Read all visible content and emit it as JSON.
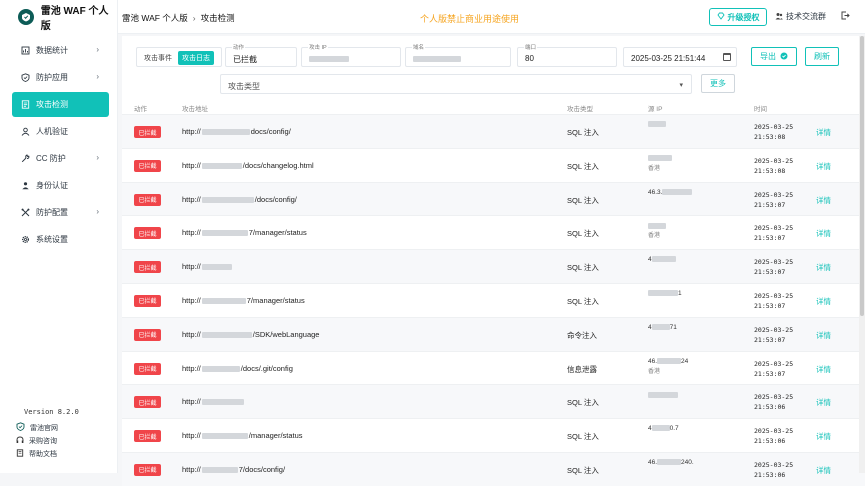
{
  "brand": {
    "name": "雷池 WAF 个人版"
  },
  "breadcrumb": {
    "app": "雷池 WAF 个人版",
    "page": "攻击检测"
  },
  "notice": "个人版禁止商业用途使用",
  "header": {
    "upgrade_label": "升级授权",
    "group_label": "技术交流群"
  },
  "sidebar": {
    "items": [
      {
        "label": "数据统计",
        "icon": "chart-icon",
        "chevron": true
      },
      {
        "label": "防护应用",
        "icon": "shield-icon",
        "chevron": true
      },
      {
        "label": "攻击检测",
        "icon": "document-icon",
        "chevron": false,
        "active": true
      },
      {
        "label": "人机验证",
        "icon": "user-icon",
        "chevron": false
      },
      {
        "label": "CC 防护",
        "icon": "wrench-icon",
        "chevron": true
      },
      {
        "label": "身份认证",
        "icon": "id-icon",
        "chevron": false
      },
      {
        "label": "防护配置",
        "icon": "tools-icon",
        "chevron": true
      },
      {
        "label": "系统设置",
        "icon": "gear-icon",
        "chevron": false
      }
    ],
    "version": "Version 8.2.0",
    "links": [
      {
        "label": "雷池官网",
        "icon": "shield-icon"
      },
      {
        "label": "采购咨询",
        "icon": "headset-icon"
      },
      {
        "label": "帮助文档",
        "icon": "book-icon"
      }
    ]
  },
  "filters": {
    "tab_label": "攻击事件",
    "tab_active": "攻击日志",
    "action": {
      "label": "动作",
      "value": "已拦截"
    },
    "source_ip": {
      "label": "攻击 IP"
    },
    "domain": {
      "label": "域名"
    },
    "port": {
      "label": "端口",
      "value": "80"
    },
    "datetime": "2025-03-25 21:51:44",
    "attack_type": {
      "placeholder": "攻击类型"
    },
    "more_label": "更多",
    "export_label": "导出",
    "refresh_label": "刷新"
  },
  "table": {
    "columns": [
      "动作",
      "攻击地址",
      "攻击类型",
      "源 IP",
      "时间"
    ],
    "detail_label": "详情",
    "rows": [
      {
        "action": "已拦截",
        "url_prefix": "http://",
        "url_suffix": "docs/config/",
        "type": "SQL 注入",
        "ip_start": "",
        "ip_end": "",
        "location": "",
        "date": "2025-03-25",
        "time": "21:53:08"
      },
      {
        "action": "已拦截",
        "url_prefix": "http://",
        "url_suffix": "/docs/changelog.html",
        "type": "SQL 注入",
        "ip_start": "",
        "ip_end": "",
        "location": "香港",
        "date": "2025-03-25",
        "time": "21:53:08"
      },
      {
        "action": "已拦截",
        "url_prefix": "http://",
        "url_suffix": "/docs/config/",
        "type": "SQL 注入",
        "ip_start": "46.3.",
        "ip_end": "",
        "location": "",
        "date": "2025-03-25",
        "time": "21:53:07"
      },
      {
        "action": "已拦截",
        "url_prefix": "http://",
        "url_suffix": "7/manager/status",
        "type": "SQL 注入",
        "ip_start": "",
        "ip_end": "",
        "location": "香港",
        "date": "2025-03-25",
        "time": "21:53:07"
      },
      {
        "action": "已拦截",
        "url_prefix": "http://",
        "url_suffix": "",
        "type": "SQL 注入",
        "ip_start": "4",
        "ip_end": "",
        "location": "",
        "date": "2025-03-25",
        "time": "21:53:07"
      },
      {
        "action": "已拦截",
        "url_prefix": "http://",
        "url_suffix": "7/manager/status",
        "type": "SQL 注入",
        "ip_start": "",
        "ip_end": "1",
        "location": "",
        "date": "2025-03-25",
        "time": "21:53:07"
      },
      {
        "action": "已拦截",
        "url_prefix": "http://",
        "url_suffix": "/SDK/webLanguage",
        "type": "命令注入",
        "ip_start": "4",
        "ip_end": "71",
        "location": "",
        "date": "2025-03-25",
        "time": "21:53:07"
      },
      {
        "action": "已拦截",
        "url_prefix": "http://",
        "url_suffix": "/docs/.git/config",
        "type": "信息泄露",
        "ip_start": "46.",
        "ip_end": "24",
        "location": "香港",
        "date": "2025-03-25",
        "time": "21:53:07"
      },
      {
        "action": "已拦截",
        "url_prefix": "http://",
        "url_suffix": "",
        "type": "SQL 注入",
        "ip_start": "",
        "ip_end": "",
        "location": "",
        "date": "2025-03-25",
        "time": "21:53:06"
      },
      {
        "action": "已拦截",
        "url_prefix": "http://",
        "url_suffix": "/manager/status",
        "type": "SQL 注入",
        "ip_start": "4",
        "ip_end": "0.7",
        "location": "",
        "date": "2025-03-25",
        "time": "21:53:06"
      },
      {
        "action": "已拦截",
        "url_prefix": "http://",
        "url_suffix": "7/docs/config/",
        "type": "SQL 注入",
        "ip_start": "46.",
        "ip_end": "240.",
        "location": "",
        "date": "2025-03-25",
        "time": "21:53:06"
      }
    ]
  }
}
